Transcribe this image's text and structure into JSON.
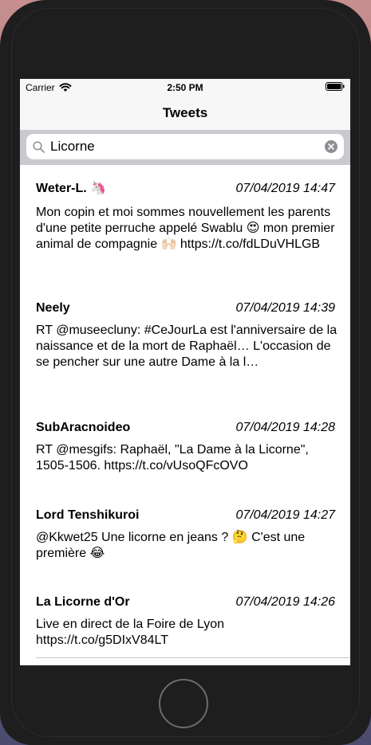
{
  "status_bar": {
    "carrier": "Carrier",
    "time": "2:50 PM"
  },
  "nav": {
    "title": "Tweets"
  },
  "search": {
    "value": "Licorne"
  },
  "tweets": [
    {
      "author": "Weter-L. 🦄",
      "date": "07/04/2019 14:47",
      "text": "Mon copin et moi sommes nouvellement les parents d'une petite perruche appelé Swablu 😍 mon premier animal de compagnie 🙌🏻 https://t.co/fdLDuVHLGB"
    },
    {
      "author": "Neely",
      "date": "07/04/2019 14:39",
      "text": "RT @museecluny: #CeJourLa est l'anniversaire de la naissance et de la mort de Raphaël… L'occasion de se pencher sur une autre Dame à la l…"
    },
    {
      "author": "SubAracnoideo",
      "date": "07/04/2019 14:28",
      "text": "RT @mesgifs: Raphaël, \"La Dame à la Licorne\", 1505-1506. https://t.co/vUsoQFcOVO"
    },
    {
      "author": "Lord Tenshikuroi",
      "date": "07/04/2019 14:27",
      "text": "@Kkwet25 Une licorne en jeans ? 🤔 C'est une première 😂"
    },
    {
      "author": "La Licorne d'Or",
      "date": "07/04/2019 14:26",
      "text": "Live en direct de la Foire de Lyon https://t.co/g5DIxV84LT"
    }
  ]
}
